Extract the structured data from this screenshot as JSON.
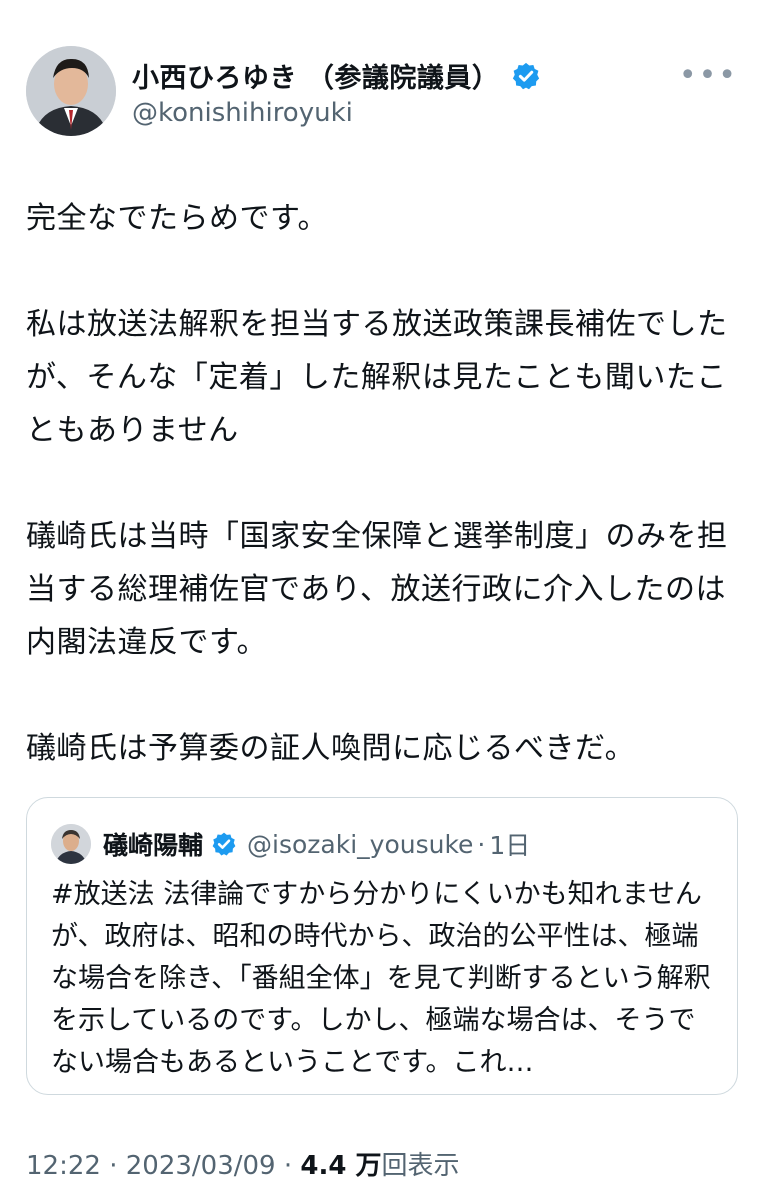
{
  "author": {
    "name": "小西ひろゆき （参議院議員）",
    "handle": "@konishihiroyuki",
    "more_label": "•••"
  },
  "tweet": {
    "text": "完全なでたらめです。\n\n私は放送法解釈を担当する放送政策課長補佐でしたが、そんな「定着」した解釈は見たことも聞いたこともありません\n\n礒崎氏は当時「国家安全保障と選挙制度」のみを担当する総理補佐官であり、放送行政に介入したのは内閣法違反です。\n\n礒崎氏は予算委の証人喚問に応じるべきだ。"
  },
  "quoted": {
    "name": "礒崎陽輔",
    "handle": "@isozaki_yousuke",
    "dot": "·",
    "time": "1日",
    "text": "#放送法 法律論ですから分かりにくいかも知れませんが、政府は、昭和の時代から、政治的公平性は、極端な場合を除き、「番組全体」を見て判断するという解釈を示しているのです。しかし、極端な場合は、そうでない場合もあるということです。これ…"
  },
  "meta": {
    "time": "12:22",
    "sep1": " · ",
    "date": "2023/03/09",
    "sep2": " · ",
    "views_count": "4.4 万",
    "views_label": "回表示"
  },
  "colors": {
    "verified": "#1d9bf0",
    "secondary": "#536471",
    "border": "#cfd9de"
  }
}
